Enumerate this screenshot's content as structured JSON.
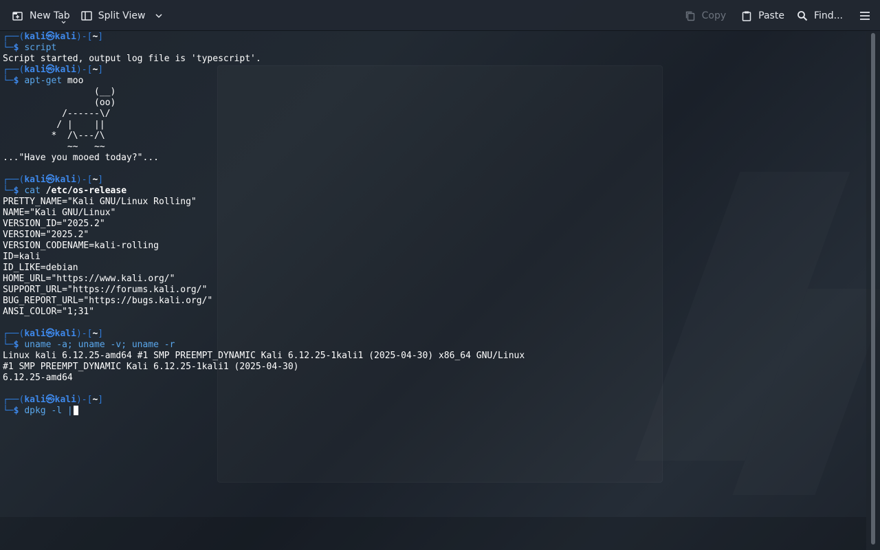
{
  "toolbar": {
    "new_tab": "New Tab",
    "split_view": "Split View",
    "copy": "Copy",
    "paste": "Paste",
    "find": "Find..."
  },
  "prompt": {
    "user": "kali",
    "host": "kali",
    "at_symbol": "㉿",
    "dir": "~"
  },
  "terminal": {
    "cmd1": "script",
    "out1": "Script started, output log file is 'typescript'.",
    "cmd2": "apt-get",
    "cmd2_args": " moo",
    "cow": [
      "                 (__)",
      "                 (oo)",
      "           /------\\/",
      "          / |    ||",
      "         *  /\\---/\\",
      "            ~~   ~~"
    ],
    "cow_msg": "...\"Have you mooed today?\"...",
    "cmd3": "cat",
    "cmd3_args": "/etc/os-release",
    "os_release": [
      "PRETTY_NAME=\"Kali GNU/Linux Rolling\"",
      "NAME=\"Kali GNU/Linux\"",
      "VERSION_ID=\"2025.2\"",
      "VERSION=\"2025.2\"",
      "VERSION_CODENAME=kali-rolling",
      "ID=kali",
      "ID_LIKE=debian",
      "HOME_URL=\"https://www.kali.org/\"",
      "SUPPORT_URL=\"https://forums.kali.org/\"",
      "BUG_REPORT_URL=\"https://bugs.kali.org/\"",
      "ANSI_COLOR=\"1;31\""
    ],
    "cmd4": "uname -a; uname -v; uname -r",
    "uname_out": [
      "Linux kali 6.12.25-amd64 #1 SMP PREEMPT_DYNAMIC Kali 6.12.25-1kali1 (2025-04-30) x86_64 GNU/Linux",
      "#1 SMP PREEMPT_DYNAMIC Kali 6.12.25-1kali1 (2025-04-30)",
      "6.12.25-amd64"
    ],
    "cmd5": "dpkg -l |"
  },
  "colors": {
    "prompt_frame": "#2f7bd9",
    "prompt_user": "#3e88ea",
    "command": "#5aa7ec",
    "text": "#ffffff",
    "toolbar_bg": "#212831"
  }
}
